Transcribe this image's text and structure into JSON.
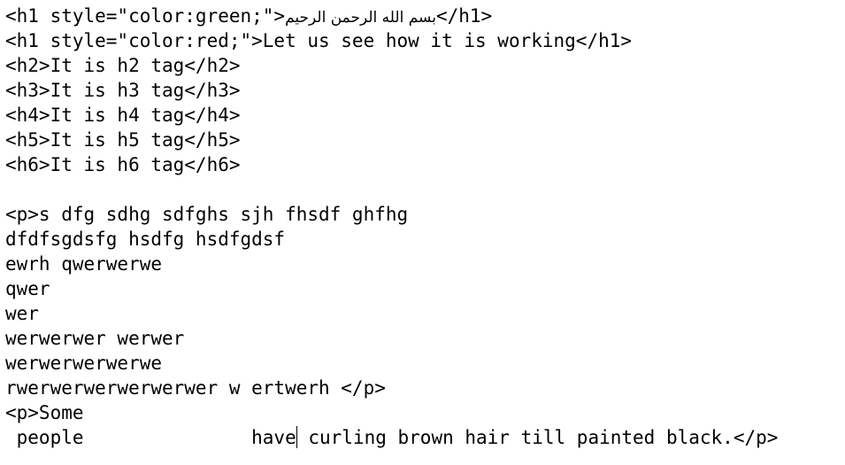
{
  "editor": {
    "lines": [
      {
        "before": "<h1 style=\"color:green;\">",
        "arabic": "بسم الله الرحمن الرحيم",
        "after": "</h1>"
      },
      {
        "text": "<h1 style=\"color:red;\">Let us see how it is working</h1>"
      },
      {
        "text": "<h2>It is h2 tag</h2>"
      },
      {
        "text": "<h3>It is h3 tag</h3>"
      },
      {
        "text": "<h4>It is h4 tag</h4>"
      },
      {
        "text": "<h5>It is h5 tag</h5>"
      },
      {
        "text": "<h6>It is h6 tag</h6>"
      },
      {
        "text": ""
      },
      {
        "text": "<p>s dfg sdhg sdfghs sjh fhsdf ghfhg"
      },
      {
        "text": "dfdfsgdsfg hsdfg hsdfgdsf"
      },
      {
        "text": "ewrh qwerwerwe"
      },
      {
        "text": "qwer"
      },
      {
        "text": "wer"
      },
      {
        "text": "werwerwer werwer"
      },
      {
        "text": "werwerwerwerwe"
      },
      {
        "text": "rwerwerwerwerwerwer w ertwerh </p>"
      },
      {
        "text": "<p>Some"
      },
      {
        "before_caret": " people               have",
        "after_caret": " curling brown hair till painted black.</p>"
      }
    ]
  }
}
